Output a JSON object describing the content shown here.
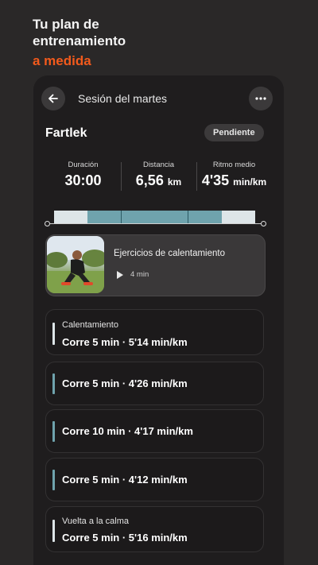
{
  "header": {
    "line1": "Tu plan de",
    "line2": "entrenamiento",
    "accent": "a medida"
  },
  "colors": {
    "accent": "#f25a1c",
    "teal": "#6fa3ad",
    "light": "#dde5e8"
  },
  "session": {
    "title": "Sesión del martes",
    "workout_name": "Fartlek",
    "status": "Pendiente",
    "back_icon": "arrow-left-icon",
    "more_icon": "more-horizontal-icon"
  },
  "stats": [
    {
      "label": "Duración",
      "value": "30:00",
      "unit": ""
    },
    {
      "label": "Distancia",
      "value": "6,56",
      "unit": "km"
    },
    {
      "label": "Ritmo medio",
      "value": "4'35",
      "unit": "min/km"
    }
  ],
  "video": {
    "title": "Ejercicios de calentamiento",
    "duration": "4 min",
    "icon": "play-icon"
  },
  "steps": [
    {
      "label": "Calentamiento",
      "text": "Corre 5 min · 5'14 min/km",
      "type": "warmup"
    },
    {
      "label": "",
      "text": "Corre 5 min · 4'26 min/km",
      "type": "effort"
    },
    {
      "label": "",
      "text": "Corre 10 min · 4'17 min/km",
      "type": "effort"
    },
    {
      "label": "",
      "text": "Corre 5 min · 4'12 min/km",
      "type": "effort"
    },
    {
      "label": "Vuelta a la calma",
      "text": "Corre 5 min · 5'16 min/km",
      "type": "cooldown"
    }
  ]
}
